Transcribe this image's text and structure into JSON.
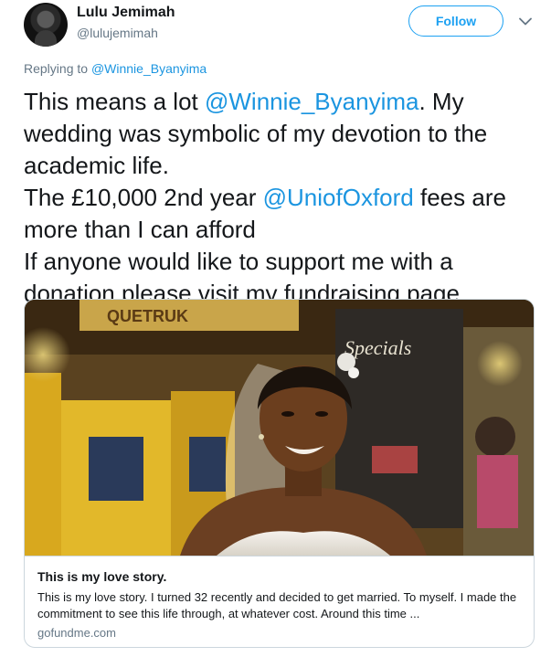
{
  "user": {
    "name": "Lulu Jemimah",
    "handle": "@lulujemimah"
  },
  "follow_label": "Follow",
  "replying": {
    "prefix": "Replying to ",
    "mention": "@Winnie_Byanyima"
  },
  "tweet": {
    "t1": "This means a lot ",
    "m1": "@Winnie_Byanyima",
    "t2": ". My wedding was symbolic of my devotion to the academic life.\nThe £10,000 2nd year ",
    "m2": "@UniofOxford",
    "t3": " fees are more than I can afford\nIf anyone would like to support me with a donation please visit my fundraising page"
  },
  "card": {
    "image_signs": {
      "top_sign": "QUETRUK",
      "chalkboard": "Specials"
    },
    "title": "This is my love story.",
    "description": "This is my love story. I turned 32 recently and decided to get married. To myself. I made the commitment to see this life through, at whatever cost. Around this time ...",
    "domain": "gofundme.com"
  },
  "colors": {
    "accent": "#1da1f2",
    "mention": "#1b95e0",
    "secondary_text": "#657786",
    "border": "#ccd6dd"
  },
  "icons": {
    "more": "chevron-down-icon"
  }
}
